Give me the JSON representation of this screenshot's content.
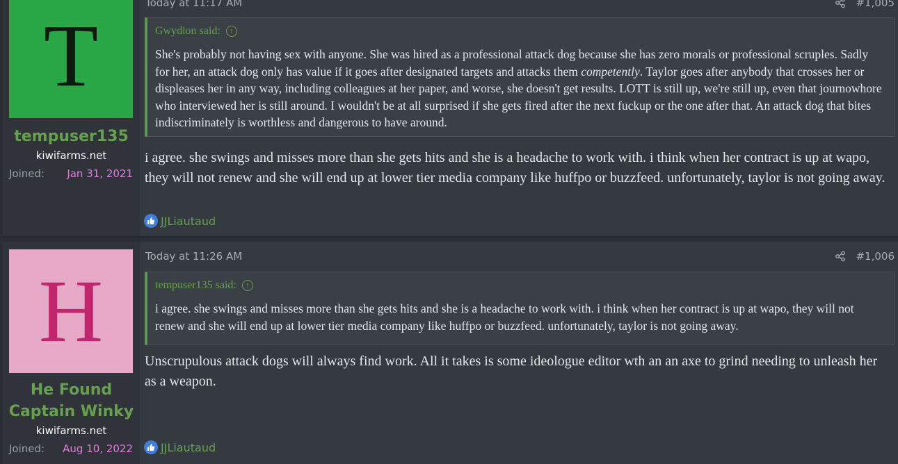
{
  "posts": [
    {
      "avatar_letter": "T",
      "username": "tempuser135",
      "user_title": "kiwifarms.net",
      "joined_label": "Joined:",
      "joined_date": "Jan 31, 2021",
      "time": "Today at 11:17 AM",
      "post_number": "#1,005",
      "quote": {
        "author": "Gwydion said:",
        "text_before": "She's probably not having sex with anyone. She was hired as a professional attack dog because she has zero morals or professional scruples. Sadly for her, an attack dog only has value if it goes after designated targets and attacks them ",
        "text_emph": "competently",
        "text_after": ". Taylor goes after anybody that crosses her or displeases her in any way, including colleagues at her paper, and worse, she doesn't get results. LOTT is still up, we're still up, even that journowhore who interviewed her is still around. I wouldn't be at all surprised if she gets fired after the next fuckup or the one after that. An attack dog that bites indiscriminately is worthless and dangerous to have around."
      },
      "message": "i agree. she swings and misses more than she gets hits and she is a headache to work with. i think when her contract is up at wapo, they will not renew and she will end up at lower tier media company like huffpo or buzzfeed. unfortunately, taylor is not going away.",
      "reaction_user": "JJLiautaud"
    },
    {
      "avatar_letter": "H",
      "username": "He Found Captain Winky",
      "user_title": "kiwifarms.net",
      "joined_label": "Joined:",
      "joined_date": "Aug 10, 2022",
      "time": "Today at 11:26 AM",
      "post_number": "#1,006",
      "quote": {
        "author": "tempuser135 said:",
        "text": "i agree. she swings and misses more than she gets hits and she is a headache to work with. i think when her contract is up at wapo, they will not renew and she will end up at lower tier media company like huffpo or buzzfeed. unfortunately, taylor is not going away."
      },
      "message": "Unscrupulous attack dogs will always find work. All it takes is some ideologue editor wth an an axe to grind needing to unleash her as a weapon.",
      "reaction_user": "JJLiautaud"
    }
  ],
  "colors": {
    "background": "#2b2e33",
    "post_bg": "#353940",
    "username": "#67a04f",
    "joined_date": "#e27de0",
    "quote_border": "#5e9c4a",
    "like_icon": "#3d7ee0"
  }
}
